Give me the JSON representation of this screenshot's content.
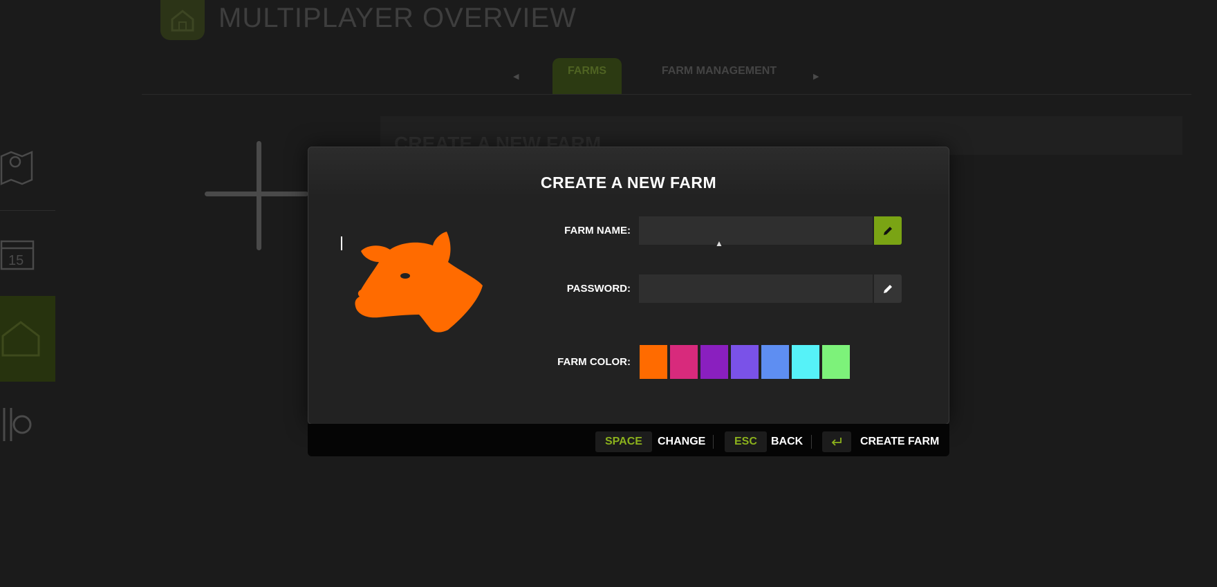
{
  "background": {
    "page_title": "MULTIPLAYER OVERVIEW",
    "tabs": [
      {
        "label": "FARMS",
        "active": true
      },
      {
        "label": "FARM MANAGEMENT",
        "active": false
      }
    ],
    "tab_prev_arrow": "◀",
    "tab_next_arrow": "▶",
    "panel_title": "CREATE A NEW FARM",
    "calendar_day": "15"
  },
  "dialog": {
    "title": "CREATE A NEW FARM",
    "logo_icon": "sheep-head-icon",
    "logo_color": "#ff6b00",
    "fields": {
      "farm_name": {
        "label": "FARM NAME:",
        "value": "",
        "placeholder": ""
      },
      "password": {
        "label": "PASSWORD:",
        "value": "",
        "placeholder": ""
      }
    },
    "farm_color_label": "FARM COLOR:",
    "colors": [
      "#ff6b00",
      "#d82a7c",
      "#8a1fbf",
      "#7a52e8",
      "#5e8ef2",
      "#56f2f8",
      "#7df27a"
    ]
  },
  "footer": {
    "change_key": "SPACE",
    "change_label": "CHANGE",
    "back_key": "ESC",
    "back_label": "BACK",
    "create_icon": "enter-key-icon",
    "create_label": "CREATE FARM"
  },
  "accent_color": "#7aa414"
}
